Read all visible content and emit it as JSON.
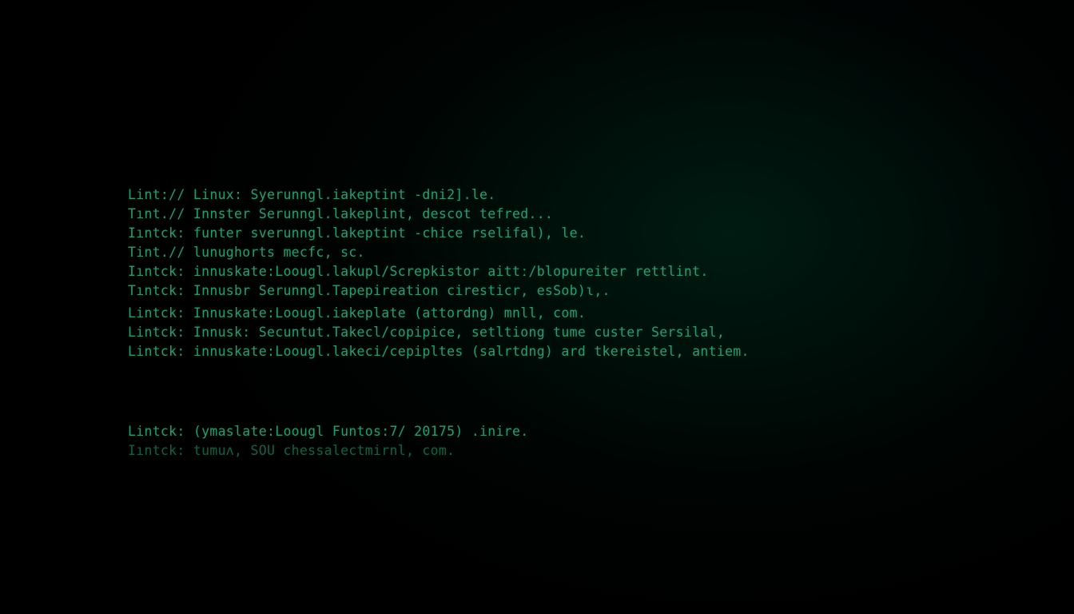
{
  "terminal": {
    "lines": [
      "Lint:// Linux: Syerunngl.iakeptint -dni2].le.",
      "Tınt.// Innster Serunngl.lakeplint, descot tefred...",
      "Iıntck: funter sverunngl.lakeptint -chice rselifal), le.",
      "Tint.// lunughorts mecfc, sc.",
      "Iıntck: innuskate:Loougl.lakupl/Screpkistor aittː/blopureiter rettlint.",
      "Tıntck: Innusbr Serunngl.Tapepireation ciresticr, esSob)ɩ,.",
      "Lintck: Innuskate:Loougl.iakeplate (attordng) mnll, com.",
      "Lintck: Innusk: Secuntut.Takecl/copipice, setltiong tume custer Sersilal,",
      "Lintck: innuskate:Loougl.lakeci/cepipltes (salrtdng) ard tkereistel, antiem."
    ],
    "footer_lines": [
      "Lintck: (ymaslate:Loougl Funtos:7/ 20175) .inire.",
      "Iıntck: tumuʌ, SOU chessalectmirnl, com."
    ]
  }
}
